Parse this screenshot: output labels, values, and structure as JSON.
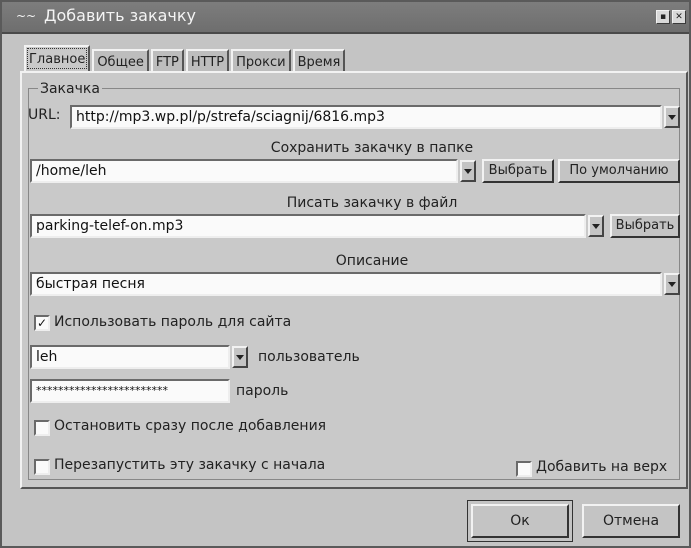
{
  "window": {
    "title": "Добавить закачку",
    "title_icon_text": "~~"
  },
  "tabs": [
    {
      "label": "Главное",
      "active": true
    },
    {
      "label": "Общее",
      "active": false
    },
    {
      "label": "FTP",
      "active": false
    },
    {
      "label": "HTTP",
      "active": false
    },
    {
      "label": "Прокси",
      "active": false
    },
    {
      "label": "Время",
      "active": false
    }
  ],
  "group": {
    "title": "Закачка"
  },
  "url": {
    "label": "URL:",
    "value": "http://mp3.wp.pl/p/strefa/sciagnij/6816.mp3"
  },
  "save_folder": {
    "label": "Сохранить закачку в папке",
    "value": "/home/leh",
    "choose_label": "Выбрать",
    "default_label": "По умолчанию"
  },
  "save_file": {
    "label": "Писать закачку в файл",
    "value": "parking-telef-on.mp3",
    "choose_label": "Выбрать"
  },
  "description": {
    "label": "Описание",
    "value": "быстрая песня"
  },
  "use_password": {
    "label": "Использовать пароль для сайта",
    "checked": true,
    "mark": "✓"
  },
  "user": {
    "value": "leh",
    "label": "пользователь"
  },
  "password": {
    "value": "************************",
    "label": "пароль"
  },
  "stop_after_add": {
    "label": "Остановить сразу после добавления",
    "checked": false
  },
  "restart": {
    "label": "Перезапустить эту закачку с начала",
    "checked": false
  },
  "add_to_top": {
    "label": "Добавить на верх",
    "checked": false
  },
  "footer": {
    "ok_label": "Ок",
    "cancel_label": "Отмена"
  },
  "colors": {
    "window_bg": "#c4c4c4",
    "titlebar": "#777777",
    "field_bg": "#fafafa"
  }
}
